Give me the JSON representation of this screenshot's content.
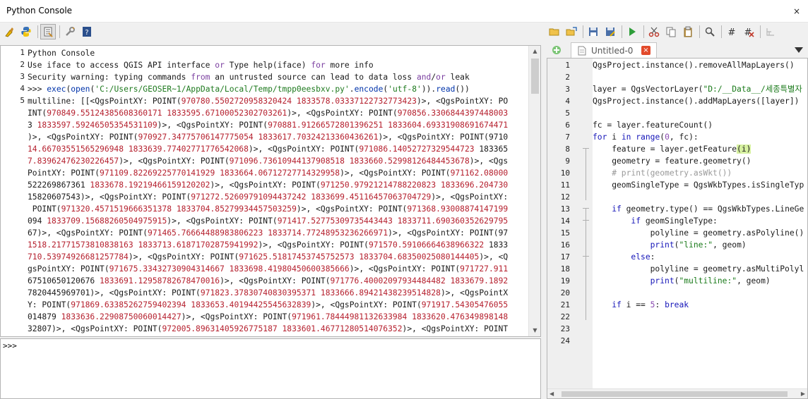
{
  "window": {
    "title": "Python Console",
    "close_glyph": "×"
  },
  "console_toolbar": [
    {
      "name": "clear-console-icon",
      "label": "Clear Console"
    },
    {
      "name": "python-icon",
      "label": "Run Command"
    },
    {
      "name": "show-editor-icon",
      "label": "Show Editor"
    },
    {
      "name": "settings-icon",
      "label": "Options"
    },
    {
      "name": "help-icon",
      "label": "Help"
    }
  ],
  "editor_toolbar": [
    "open-file-icon",
    "open-in-external-editor-icon",
    "save-icon",
    "save-as-icon",
    "run-script-icon",
    "cut-icon",
    "copy-icon",
    "paste-icon",
    "find-icon",
    "comment-icon",
    "uncomment-icon",
    "object-inspector-icon"
  ],
  "console": {
    "lines": [
      {
        "n": "1",
        "text": "Python Console"
      },
      {
        "n": "2",
        "text": "Use iface to access QGIS API interface or Type help(iface) for more info"
      },
      {
        "n": "3",
        "text": "Security warning: typing commands from an untrusted source can lead to data loss and/or leak"
      },
      {
        "n": "4",
        "text": ">>> exec(open('C:/Users/GEOSER~1/AppData/Local/Temp/tmpp0eesbxv.py'.encode('utf-8')).read())"
      },
      {
        "n": "5",
        "text": "multiline: [[<QgsPointXY: POINT(970780.5502720958320424 1833578.03337122732773423)>, <QgsPointXY: PO"
      }
    ],
    "wrapped": [
      "INT(970849.55124385608360171 1833595.67100052302703261)>, <QgsPointXY: POINT(970856.3306844397448003",
      "3 1833597.59246505354531109)>, <QgsPointXY: POINT(970881.91266572801396251 1833604.69331908691674471",
      ")>, <QgsPointXY: POINT(970927.34775706147775054 1833617.70324213360436261)>, <QgsPointXY: POINT(9710",
      "14.66703551565296948 1833639.77402771776542068)>, <QgsPointXY: POINT(971086.14052727329544723 183365",
      "7.83962476230226457)>, <QgsPointXY: POINT(971096.73610944137908518 1833660.52998126484453678)>, <Qgs",
      "PointXY: POINT(971109.82269225770141929 1833664.06712727714329958)>, <QgsPointXY: POINT(971162.08000",
      "522269867361 1833678.19219466159120202)>, <QgsPointXY: POINT(971250.97921214788220823 1833696.204730",
      "15820607543)>, <QgsPointXY: POINT(971272.52609791094437242 1833699.45116457063704729)>, <QgsPointXY:",
      " POINT(971320.4571519666351378 1833704.85279934457503259)>, <QgsPointXY: POINT(971368.93008874147199",
      "094 1833709.15688260504975915)>, <QgsPointXY: POINT(971417.52775309735443443 1833711.690360352629795",
      "67)>, <QgsPointXY: POINT(971465.76664488983806223 1833714.77248953236266971)>, <QgsPointXY: POINT(97",
      "1518.21771573810838163 1833713.61871702875941992)>, <QgsPointXY: POINT(971570.59106664638966322 1833",
      "710.53974926681257784)>, <QgsPointXY: POINT(971625.51817453745752573 1833704.68350025080144405)>, <Q",
      "gsPointXY: POINT(971675.33432730904314667 1833698.41980450600385666)>, <QgsPointXY: POINT(971727.911",
      "67510650120676 1833691.12958782678470016)>, <QgsPointXY: POINT(971776.40002097934484482 1833679.1892",
      "7820445969701)>, <QgsPointXY: POINT(971823.37830740830395371 1833666.89421438239514828)>, <QgsPointX",
      "Y: POINT(971869.63385262759402394 1833653.40194425545632839)>, <QgsPointXY: POINT(971917.54305476055",
      "014879 1833636.22908750060014427)>, <QgsPointXY: POINT(971961.78444981132633984 1833620.476349898148",
      "32807)>, <QgsPointXY: POINT(972005.89631405926775187 1833601.46771280514076352)>, <QgsPointXY: POINT"
    ],
    "input_prompt": ">>>"
  },
  "editor": {
    "tab_label": "Untitled-0",
    "tab_close": "×",
    "line_numbers": [
      "1",
      "2",
      "3",
      "4",
      "5",
      "6",
      "7",
      "8",
      "9",
      "10",
      "11",
      "12",
      "13",
      "14",
      "15",
      "16",
      "17",
      "18",
      "19",
      "20",
      "21",
      "22",
      "23",
      "24"
    ],
    "code": [
      "QgsProject.instance().removeAllMapLayers()",
      "",
      "layer = QgsVectorLayer(\"D:/__Data__/세종특별자",
      "QgsProject.instance().addMapLayers([layer])",
      "",
      "fc = layer.featureCount()",
      "for i in range(0, fc):",
      "    feature = layer.getFeature(i)",
      "    geometry = feature.geometry()",
      "    # print(geometry.asWkt())",
      "    geomSingleType = QgsWkbTypes.isSingleTyp",
      "",
      "    if geometry.type() == QgsWkbTypes.LineGe",
      "        if geomSingleType:",
      "            polyline = geometry.asPolyline()",
      "            print(\"line:\", geom)",
      "        else:",
      "            polyline = geometry.asMultiPolyl",
      "            print(\"multiline:\", geom)",
      "",
      "    if i == 5: break",
      "",
      "",
      ""
    ]
  },
  "colors": {
    "accent_close": "#e24a2b",
    "keyword": "#1414b8",
    "string": "#1a7a1a"
  }
}
